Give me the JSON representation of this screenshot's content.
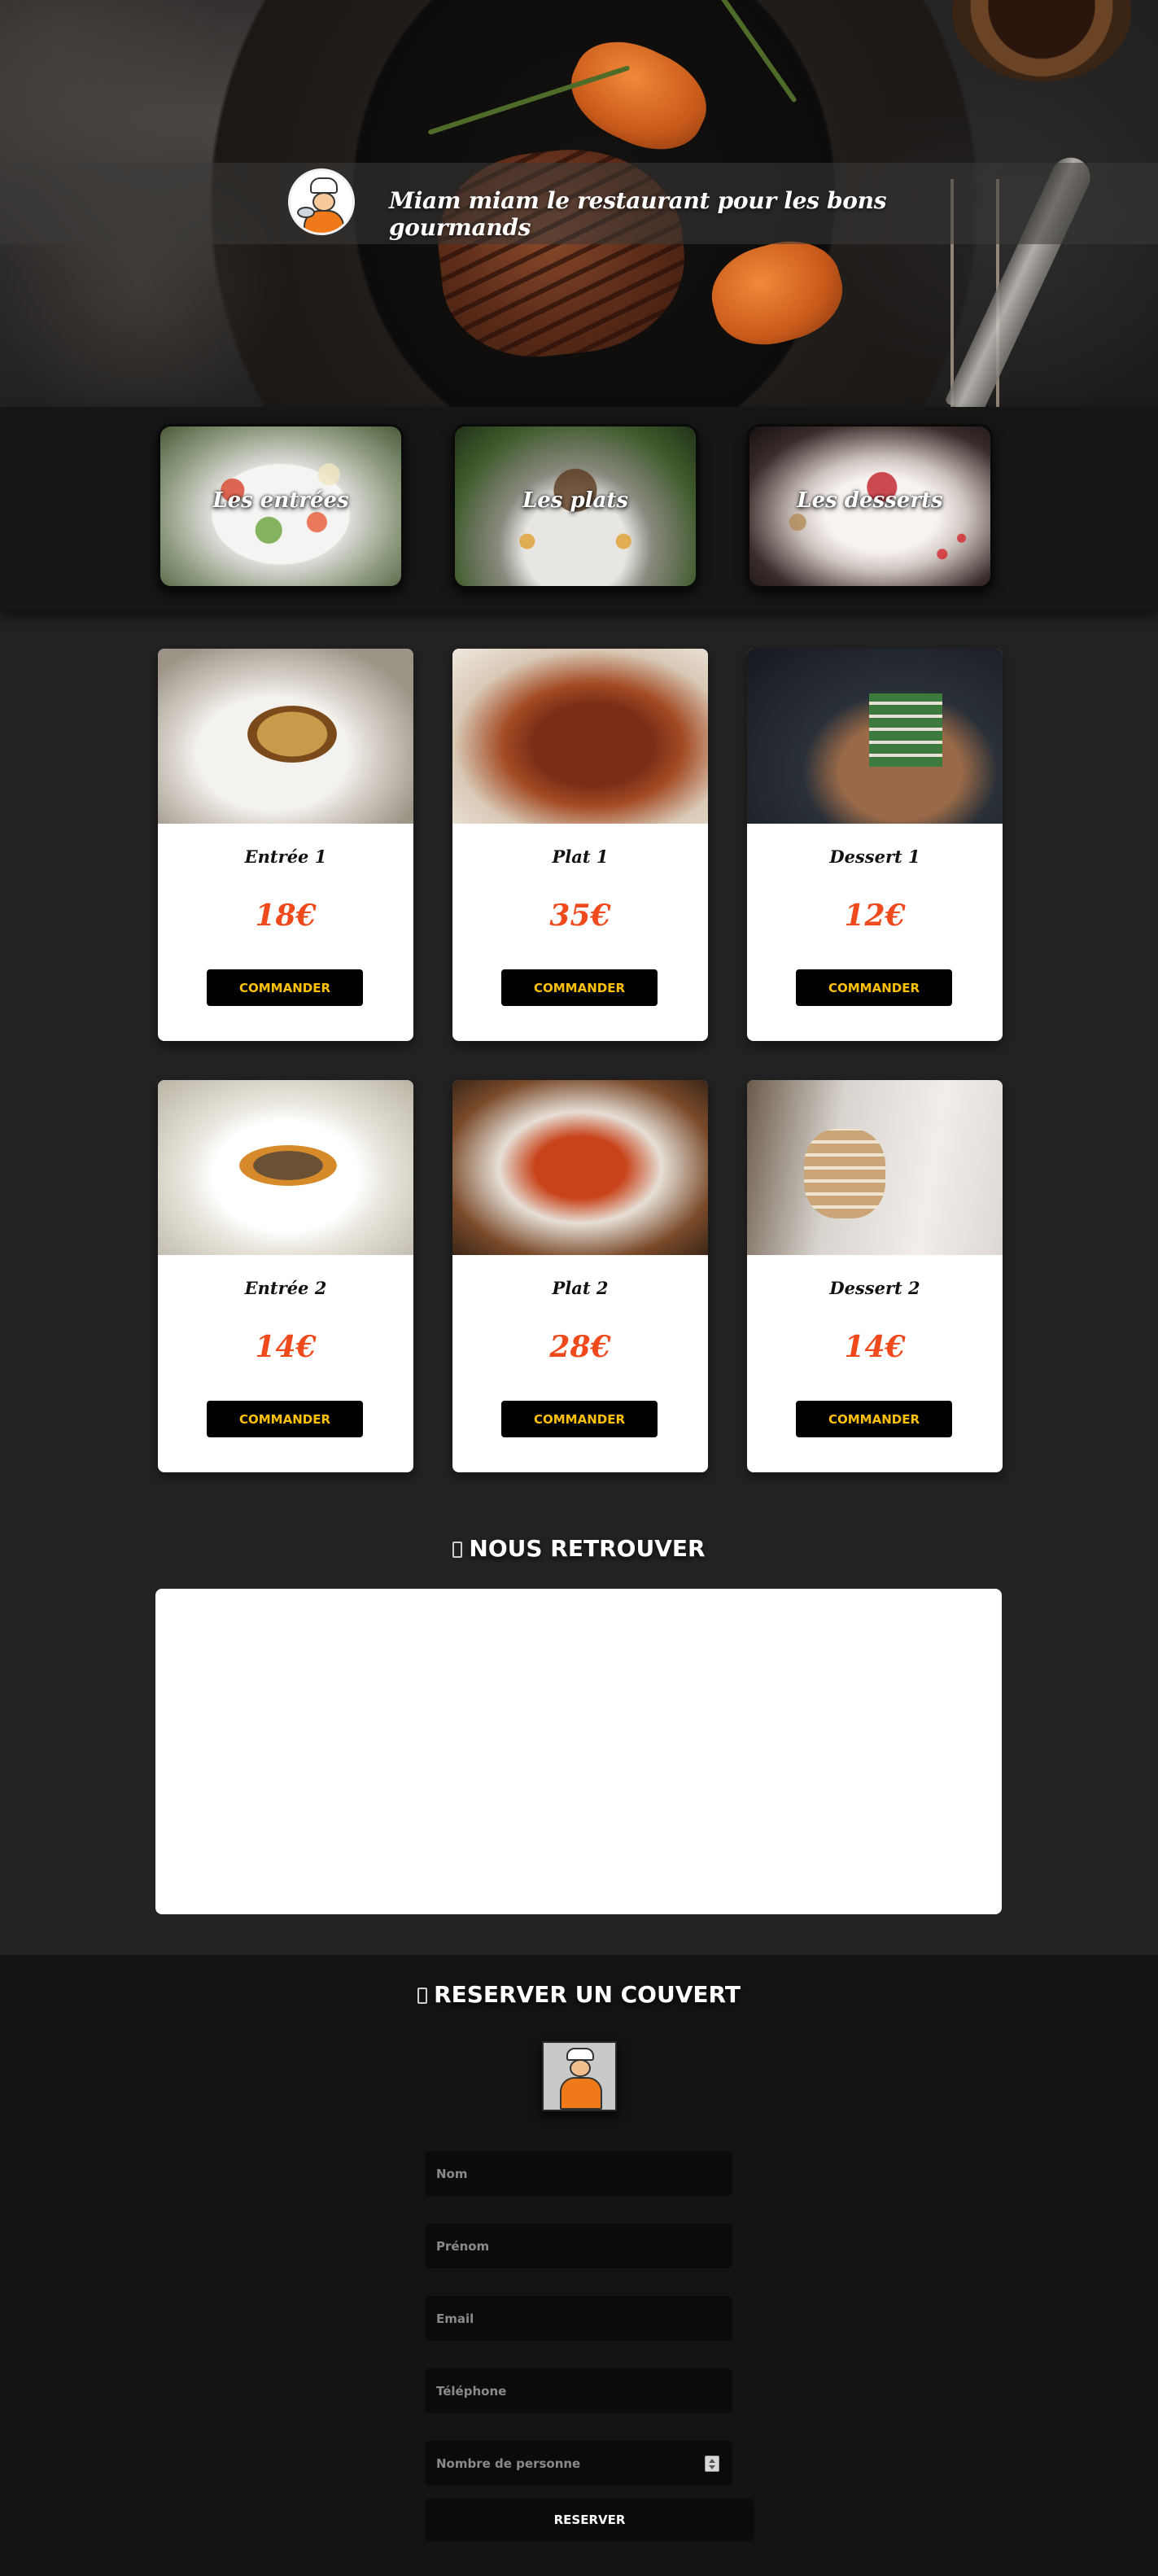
{
  "hero": {
    "title": "Miam miam le restaurant pour les bons gourmands"
  },
  "categories": [
    {
      "label": "Les entrées"
    },
    {
      "label": "Les plats"
    },
    {
      "label": "Les desserts"
    }
  ],
  "menu": [
    {
      "name": "Entrée 1",
      "price": "18€",
      "button": "COMMANDER"
    },
    {
      "name": "Plat 1",
      "price": "35€",
      "button": "COMMANDER"
    },
    {
      "name": "Dessert 1",
      "price": "12€",
      "button": "COMMANDER"
    },
    {
      "name": "Entrée 2",
      "price": "14€",
      "button": "COMMANDER"
    },
    {
      "name": "Plat 2",
      "price": "28€",
      "button": "COMMANDER"
    },
    {
      "name": "Dessert 2",
      "price": "14€",
      "button": "COMMANDER"
    }
  ],
  "location": {
    "title": "NOUS RETROUVER"
  },
  "reservation": {
    "title": "RESERVER UN COUVERT",
    "fields": {
      "nom": "Nom",
      "prenom": "Prénom",
      "email": "Email",
      "telephone": "Téléphone",
      "personnes": "Nombre de personne"
    },
    "submit": "RESERVER"
  },
  "colors": {
    "accent_price": "#f0491c",
    "button_text": "#ffc107",
    "page_background": "#222222",
    "reservation_background": "#131313"
  }
}
